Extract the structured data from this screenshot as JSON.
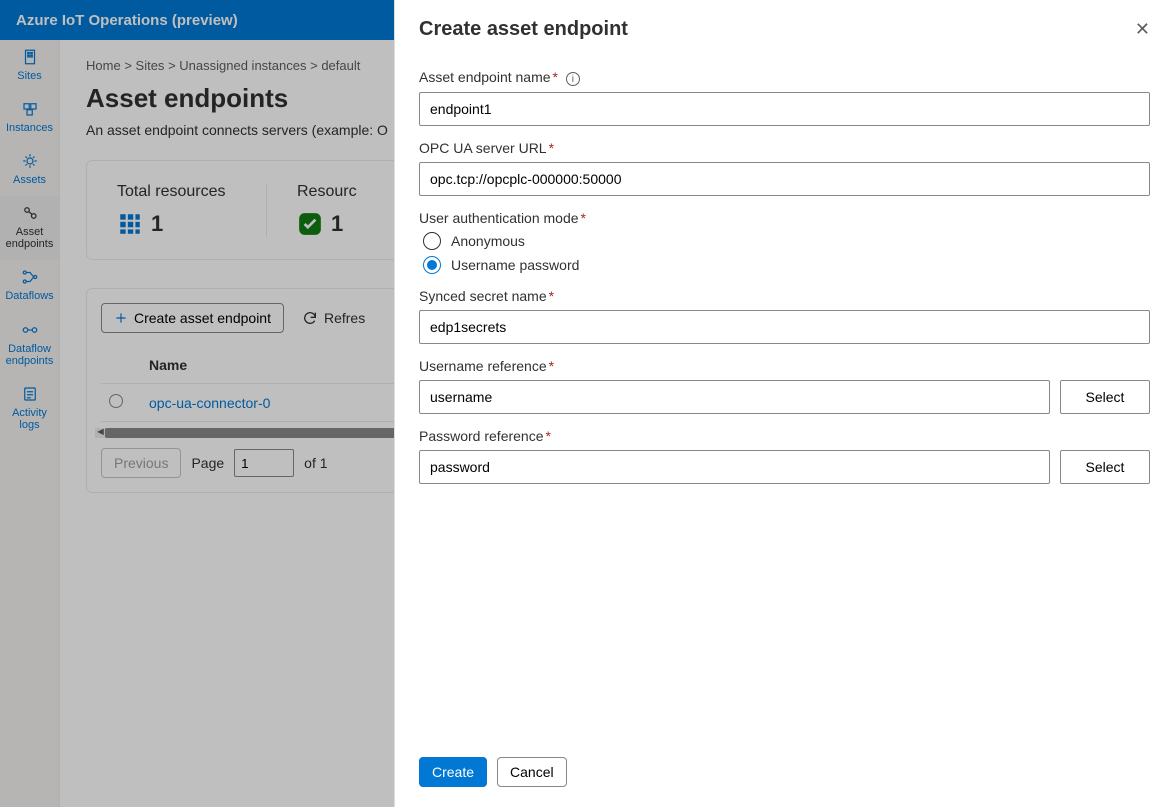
{
  "topbar": {
    "title": "Azure IoT Operations (preview)"
  },
  "sidenav": {
    "items": [
      {
        "label": "Sites",
        "icon": "sites"
      },
      {
        "label": "Instances",
        "icon": "instances"
      },
      {
        "label": "Assets",
        "icon": "assets"
      },
      {
        "label": "Asset endpoints",
        "icon": "asset-endpoints",
        "active": true
      },
      {
        "label": "Dataflows",
        "icon": "dataflows"
      },
      {
        "label": "Dataflow endpoints",
        "icon": "dataflow-endpoints"
      },
      {
        "label": "Activity logs",
        "icon": "activity-logs"
      }
    ]
  },
  "breadcrumb": {
    "items": [
      "Home",
      "Sites",
      "Unassigned instances",
      "default"
    ],
    "sep": " > "
  },
  "page": {
    "title": "Asset endpoints",
    "subtitle": "An asset endpoint connects servers (example: O"
  },
  "summary": {
    "total_label": "Total resources",
    "total_value": "1",
    "running_label": "Resourc",
    "running_value": "1"
  },
  "toolbar": {
    "create_label": "Create asset endpoint",
    "refresh_label": "Refres"
  },
  "table": {
    "header_name": "Name",
    "rows": [
      {
        "name": "opc-ua-connector-0"
      }
    ]
  },
  "pager": {
    "previous": "Previous",
    "page_label": "Page",
    "page_value": "1",
    "of_label": "of 1"
  },
  "panel": {
    "title": "Create asset endpoint",
    "labels": {
      "endpoint_name": "Asset endpoint name",
      "server_url": "OPC UA server URL",
      "auth_mode": "User authentication mode",
      "auth_anonymous": "Anonymous",
      "auth_userpass": "Username password",
      "secret_name": "Synced secret name",
      "username_ref": "Username reference",
      "password_ref": "Password reference",
      "select": "Select"
    },
    "values": {
      "endpoint_name": "endpoint1",
      "server_url": "opc.tcp://opcplc-000000:50000",
      "auth_mode": "userpass",
      "secret_name": "edp1secrets",
      "username_ref": "username",
      "password_ref": "password"
    },
    "footer": {
      "create": "Create",
      "cancel": "Cancel"
    }
  }
}
